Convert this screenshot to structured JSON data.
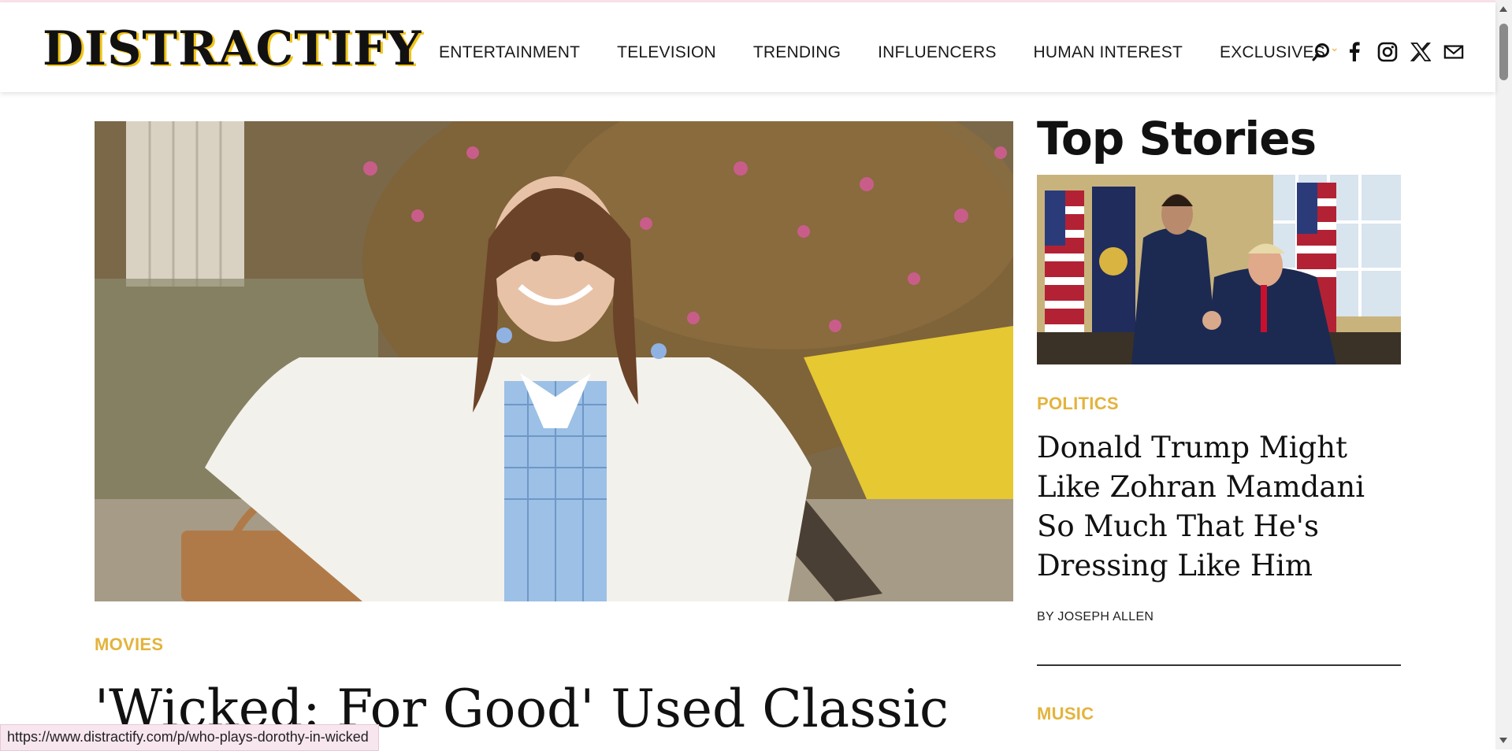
{
  "header": {
    "logo": "DISTRACTIFY",
    "nav": [
      "ENTERTAINMENT",
      "TELEVISION",
      "TRENDING",
      "INFLUENCERS",
      "HUMAN INTEREST",
      "EXCLUSIVES"
    ],
    "icons": [
      "search-icon",
      "facebook-icon",
      "instagram-icon",
      "x-icon",
      "mail-icon"
    ]
  },
  "hero": {
    "category": "MOVIES",
    "title": "'Wicked: For Good' Used Classic"
  },
  "sidebar": {
    "heading": "Top Stories",
    "story1": {
      "category": "POLITICS",
      "title": "Donald Trump Might Like Zohran Mamdani So Much That He's Dressing Like Him",
      "byline": "BY JOSEPH ALLEN"
    },
    "story2": {
      "category": "MUSIC"
    }
  },
  "status_url": "https://www.distractify.com/p/who-plays-dorothy-in-wicked",
  "colors": {
    "accent": "#e3b33c",
    "text": "#111111"
  }
}
